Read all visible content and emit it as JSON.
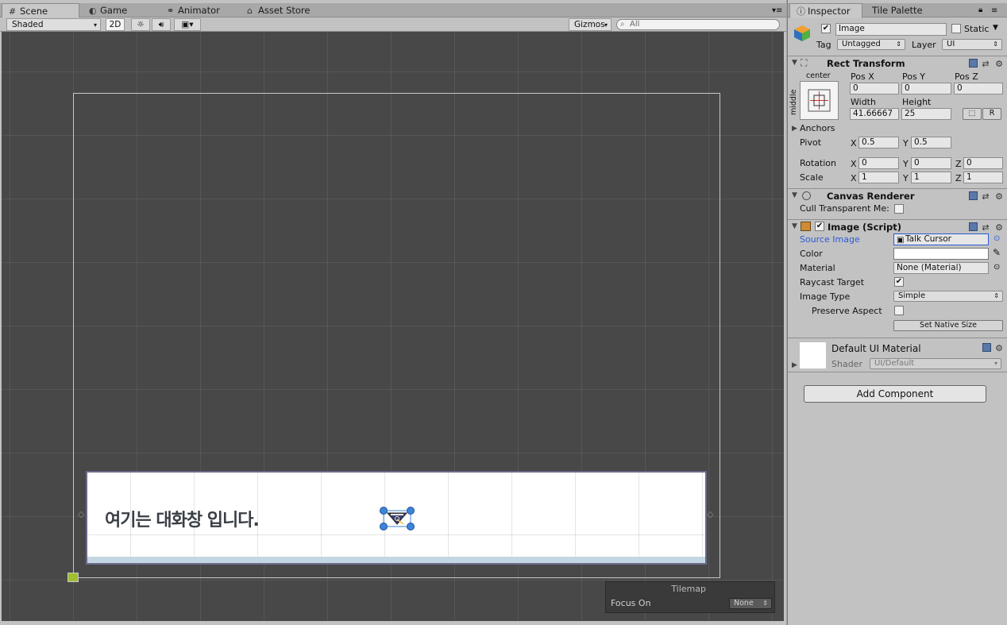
{
  "left_tabs": [
    {
      "label": "Scene",
      "icon": "grid-icon"
    },
    {
      "label": "Game",
      "icon": "pacman-icon"
    },
    {
      "label": "Animator",
      "icon": "animator-icon"
    },
    {
      "label": "Asset Store",
      "icon": "store-icon"
    }
  ],
  "scene_toolbar": {
    "shading": "Shaded",
    "mode_2d": "2D",
    "gizmos": "Gizmos",
    "search_placeholder": "All"
  },
  "scene": {
    "dialog_text": "여기는 대화창 입니다.",
    "tilemap": {
      "title": "Tilemap",
      "focus_label": "Focus On",
      "focus_value": "None"
    }
  },
  "right_tabs": [
    {
      "label": "Inspector",
      "icon": "info-icon"
    },
    {
      "label": "Tile Palette"
    }
  ],
  "inspector": {
    "object_name": "Image",
    "active": true,
    "static_label": "Static",
    "static": false,
    "tag_label": "Tag",
    "tag_value": "Untagged",
    "layer_label": "Layer",
    "layer_value": "UI",
    "rect_transform": {
      "title": "Rect Transform",
      "anchor_h": "center",
      "anchor_v": "middle",
      "pos_x_label": "Pos X",
      "pos_x": "0",
      "pos_y_label": "Pos Y",
      "pos_y": "0",
      "pos_z_label": "Pos Z",
      "pos_z": "0",
      "width_label": "Width",
      "width": "41.66667",
      "height_label": "Height",
      "height": "25",
      "r_button": "R",
      "anchors_label": "Anchors",
      "pivot_label": "Pivot",
      "pivot_x": "0.5",
      "pivot_y": "0.5",
      "rotation_label": "Rotation",
      "rot_x": "0",
      "rot_y": "0",
      "rot_z": "0",
      "scale_label": "Scale",
      "scale_x": "1",
      "scale_y": "1",
      "scale_z": "1",
      "x": "X",
      "y": "Y",
      "z": "Z"
    },
    "canvas_renderer": {
      "title": "Canvas Renderer",
      "cull_label": "Cull Transparent Me:",
      "cull": false
    },
    "image_script": {
      "title": "Image (Script)",
      "enabled": true,
      "source_label": "Source Image",
      "source_value": "Talk Cursor",
      "color_label": "Color",
      "color_value": "#ffffff",
      "material_label": "Material",
      "material_value": "None (Material)",
      "raycast_label": "Raycast Target",
      "raycast": true,
      "type_label": "Image Type",
      "type_value": "Simple",
      "preserve_label": "Preserve Aspect",
      "preserve": false,
      "native_size_button": "Set Native Size"
    },
    "material_preview": {
      "name": "Default UI Material",
      "shader_label": "Shader",
      "shader_value": "UI/Default"
    },
    "add_component": "Add Component"
  },
  "colors": {
    "accent_blue": "#2a5bd7",
    "viewport_bg": "#484848",
    "panel_bg": "#c2c2c2"
  }
}
